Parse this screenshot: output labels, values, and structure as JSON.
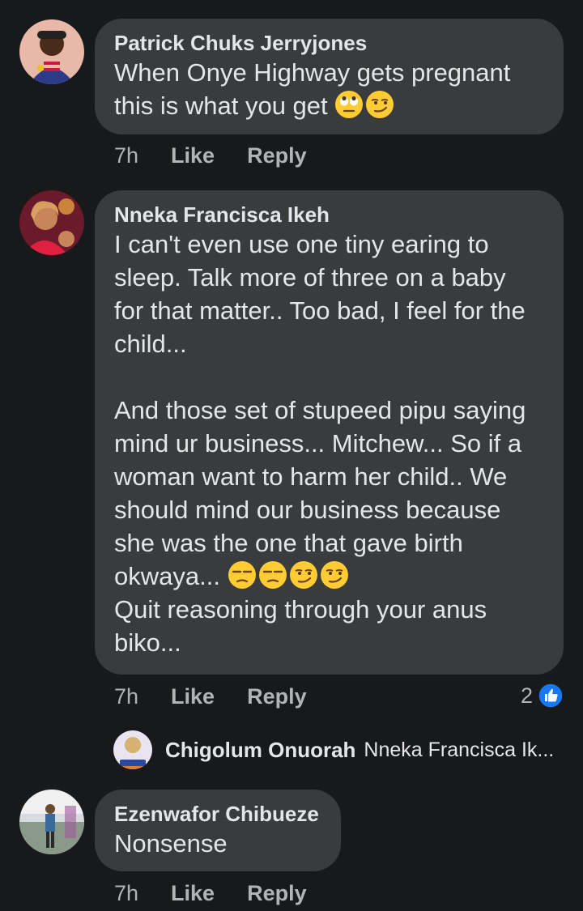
{
  "comments": [
    {
      "author": "Patrick Chuks Jerryjones",
      "line1": "When Onye Highway gets pregnant",
      "line2": "this is what you get ",
      "emojis": [
        "face-with-rolling-eyes",
        "smirking-face"
      ],
      "time": "7h",
      "like": "Like",
      "reply": "Reply"
    },
    {
      "author": "Nneka Francisca Ikeh",
      "para1": "I can't even use one tiny earing to\nsleep. Talk more of three on a baby\nfor that matter.. Too bad, I feel for the\nchild...",
      "para2": "And those set of stupeed pipu saying\nmind ur business... Mitchew... So if a\nwoman want to harm her child.. We\nshould mind our business because\nshe was the one that gave birth",
      "line_emoji": "okwaya... ",
      "emojis": [
        "unamused-face",
        "unamused-face",
        "smirking-face",
        "smirking-face"
      ],
      "para3": "Quit reasoning through your anus\nbiko...",
      "time": "7h",
      "like": "Like",
      "reply": "Reply",
      "reaction_count": "2",
      "reply_preview": {
        "author": "Chigolum Onuorah",
        "snippet": "Nneka Francisca Ik..."
      }
    },
    {
      "author": "Ezenwafor Chibueze",
      "text": "Nonsense",
      "time": "7h",
      "like": "Like",
      "reply": "Reply"
    }
  ],
  "colors": {
    "background": "#18191a",
    "bubble": "#3a3b3c",
    "text": "#e4e6eb",
    "meta": "#b0b3b8",
    "like_blue": "#1877f2"
  }
}
